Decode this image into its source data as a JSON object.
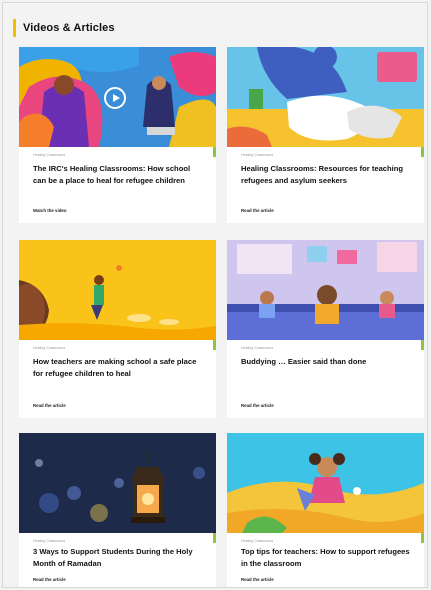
{
  "section": {
    "title": "Videos & Articles"
  },
  "colors": {
    "header_accent": "#f5bd00",
    "card_accent": "#8cc63f"
  },
  "cards": [
    {
      "eyebrow": "Healing Classrooms",
      "title": "The IRC's Healing Classrooms: How school can be a place to heal for refugee children",
      "link": "Watch the video",
      "media": "video",
      "play_icon": "play-circle-icon"
    },
    {
      "eyebrow": "Healing Classrooms",
      "title": "Healing Classrooms: Resources for teaching refugees and asylum seekers",
      "link": "Read the article",
      "media": "article"
    },
    {
      "eyebrow": "Healing Classrooms",
      "title": "How teachers are making school a safe place for refugee children to heal",
      "link": "Read the article",
      "media": "article"
    },
    {
      "eyebrow": "Healing Classrooms",
      "title": "Buddying … Easier said than done",
      "link": "Read the article",
      "media": "article"
    },
    {
      "eyebrow": "Healing Classrooms",
      "title": "3 Ways to Support Students During the Holy Month of Ramadan",
      "link": "Read the article",
      "media": "article"
    },
    {
      "eyebrow": "Healing Classrooms",
      "title": "Top tips for teachers: How to support refugees in the classroom",
      "link": "Read the article",
      "media": "article"
    }
  ]
}
